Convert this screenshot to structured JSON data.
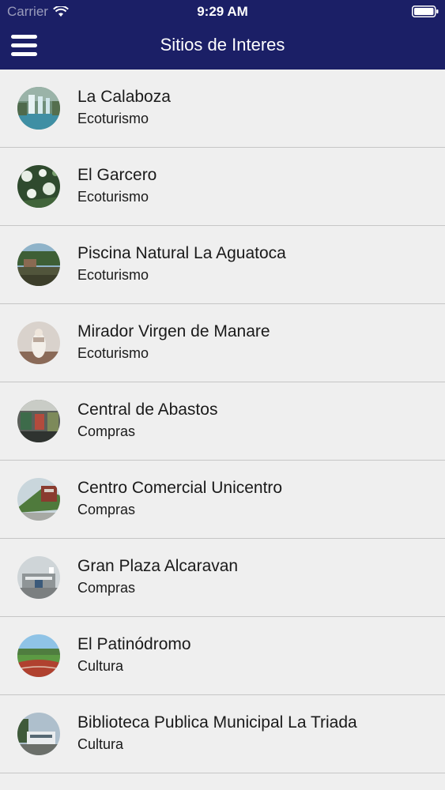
{
  "status_bar": {
    "carrier": "Carrier",
    "time": "9:29 AM",
    "wifi_icon": "wifi-icon",
    "battery_icon": "battery-icon"
  },
  "header": {
    "title": "Sitios de Interes",
    "menu_icon": "hamburger-menu-icon",
    "background_color": "#1b1f66"
  },
  "list": {
    "items": [
      {
        "title": "La Calaboza",
        "category": "Ecoturismo",
        "thumbnail": "waterfall-photo"
      },
      {
        "title": "El Garcero",
        "category": "Ecoturismo",
        "thumbnail": "white-herons-photo"
      },
      {
        "title": "Piscina Natural La Aguatoca",
        "category": "Ecoturismo",
        "thumbnail": "natural-pool-photo"
      },
      {
        "title": "Mirador Virgen de Manare",
        "category": "Ecoturismo",
        "thumbnail": "virgin-statue-photo"
      },
      {
        "title": "Central de Abastos",
        "category": "Compras",
        "thumbnail": "market-photo"
      },
      {
        "title": "Centro Comercial Unicentro",
        "category": "Compras",
        "thumbnail": "mall-exterior-photo"
      },
      {
        "title": "Gran Plaza Alcaravan",
        "category": "Compras",
        "thumbnail": "plaza-building-photo"
      },
      {
        "title": "El Patinódromo",
        "category": "Cultura",
        "thumbnail": "skating-track-photo"
      },
      {
        "title": "Biblioteca Publica Municipal La Triada",
        "category": "Cultura",
        "thumbnail": "library-building-photo"
      }
    ]
  }
}
